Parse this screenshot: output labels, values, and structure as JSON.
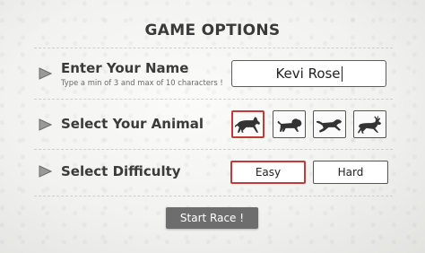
{
  "title": "GAME OPTIONS",
  "name_section": {
    "label": "Enter Your Name",
    "hint": "Type a min of 3 and max of 10 characters !",
    "input_value": "Kevi Rose"
  },
  "animal_section": {
    "label": "Select Your Animal",
    "options": [
      {
        "icon": "horse-icon",
        "selected": true
      },
      {
        "icon": "lion-icon",
        "selected": false
      },
      {
        "icon": "cheetah-icon",
        "selected": false
      },
      {
        "icon": "deer-icon",
        "selected": false
      }
    ]
  },
  "difficulty_section": {
    "label": "Select Difficulty",
    "options": [
      {
        "label": "Easy",
        "selected": true
      },
      {
        "label": "Hard",
        "selected": false
      }
    ]
  },
  "start_button": "Start Race !",
  "colors": {
    "accent_selected": "#c43a3a",
    "button_bg": "#6d6d6d",
    "text": "#3b3b3b"
  }
}
